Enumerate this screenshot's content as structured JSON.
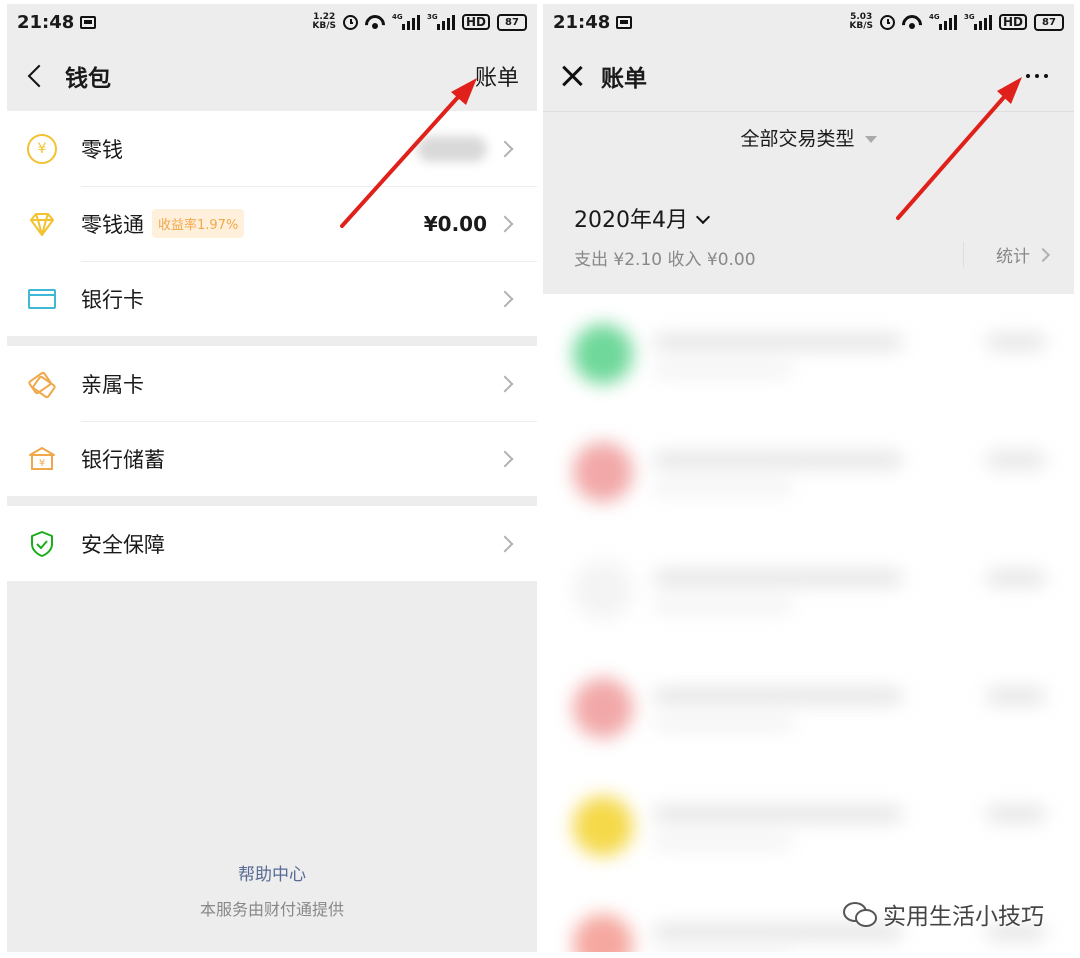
{
  "left": {
    "status": {
      "time": "21:48",
      "speed_top": "1.22",
      "speed_unit": "KB/S",
      "net1": "4G",
      "net2": "3G",
      "hd": "HD",
      "battery": "87"
    },
    "nav": {
      "title": "钱包",
      "right": "账单"
    },
    "groups": [
      {
        "items": [
          {
            "icon": "coin-icon",
            "label": "零钱",
            "value": "",
            "blurred": true
          },
          {
            "icon": "diamond-icon",
            "label": "零钱通",
            "badge": "收益率1.97%",
            "value": "¥0.00"
          },
          {
            "icon": "bank-card-icon",
            "label": "银行卡",
            "value": ""
          }
        ]
      },
      {
        "items": [
          {
            "icon": "family-card-icon",
            "label": "亲属卡",
            "value": ""
          },
          {
            "icon": "bank-savings-icon",
            "label": "银行储蓄",
            "value": ""
          }
        ]
      },
      {
        "items": [
          {
            "icon": "shield-icon",
            "label": "安全保障",
            "value": ""
          }
        ]
      }
    ],
    "footer": {
      "help": "帮助中心",
      "provider": "本服务由财付通提供"
    }
  },
  "right": {
    "status": {
      "time": "21:48",
      "speed_top": "5.03",
      "speed_unit": "KB/S",
      "net1": "4G",
      "net2": "3G",
      "hd": "HD",
      "battery": "87"
    },
    "nav": {
      "title": "账单"
    },
    "filter": "全部交易类型",
    "month": "2020年4月",
    "summary": "支出 ¥2.10 收入 ¥0.00",
    "stats": "统计",
    "transactions": [
      {
        "color": "#6fd89a"
      },
      {
        "color": "#f2a8a8"
      },
      {
        "color": "#f4f4f4"
      },
      {
        "color": "#f2a8a8"
      },
      {
        "color": "#f5d94a"
      },
      {
        "color": "#f5a8a0"
      }
    ]
  },
  "watermark": "实用生活小技巧",
  "colors": {
    "arrow": "#e0201a",
    "link": "#576b95",
    "badge_bg": "#fff0dc",
    "badge_text": "#f0a84a"
  }
}
